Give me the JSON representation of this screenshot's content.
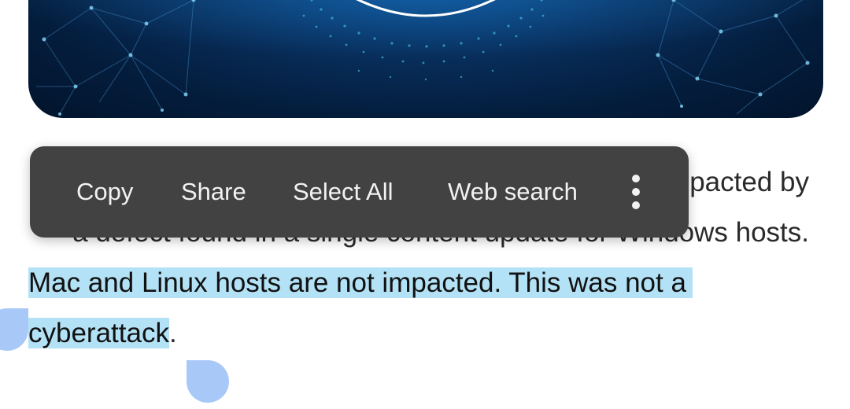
{
  "article": {
    "line1_partial": "pacted by",
    "line2_partial": "a defect found in a single content update for Windows hosts.",
    "line3_selected": "Mac and Linux hosts are not impacted. This was not a",
    "line4_selected": "cyberattack",
    "line4_rest": "."
  },
  "toolbar": {
    "copy_label": "Copy",
    "share_label": "Share",
    "select_all_label": "Select All",
    "web_search_label": "Web search",
    "more_icon": "more-vert-icon"
  },
  "colors": {
    "toolbar_bg": "#424242",
    "selection_highlight": "#b3e1f5",
    "selection_handle": "#a8c8f8",
    "hero_bg": "#05254a"
  }
}
